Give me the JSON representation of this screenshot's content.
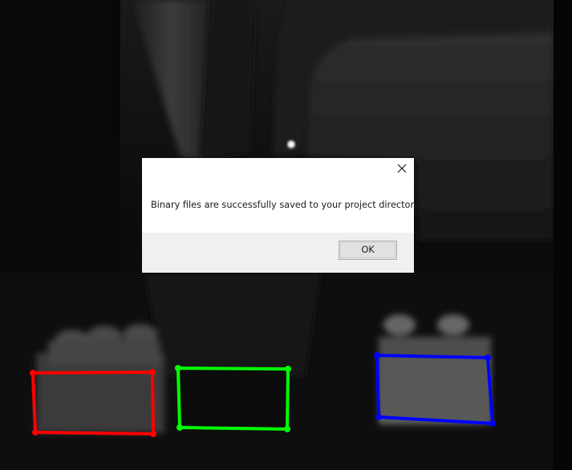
{
  "dialog": {
    "message": "Binary files are successfully saved to your project directory.",
    "ok_label": "OK",
    "close_icon": "close-icon"
  },
  "annotations": [
    {
      "name": "red-box",
      "color": "#ff0000"
    },
    {
      "name": "green-box",
      "color": "#00ff00"
    },
    {
      "name": "blue-box",
      "color": "#0000ff"
    }
  ]
}
